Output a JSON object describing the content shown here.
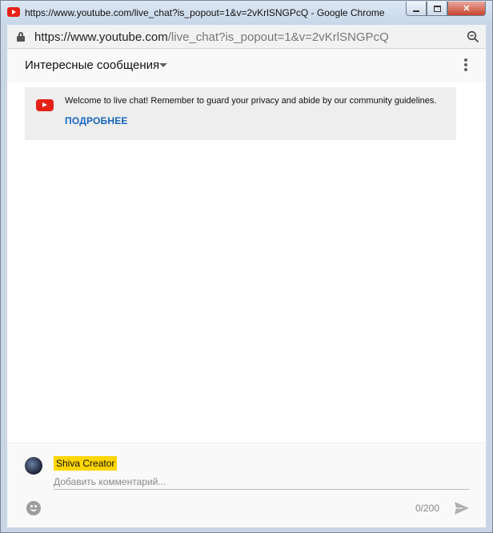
{
  "window": {
    "title": "https://www.youtube.com/live_chat?is_popout=1&v=2vKrlSNGPcQ - Google Chrome",
    "minimize_label": "",
    "close_label": "✕"
  },
  "addressbar": {
    "url_host": "https://www.youtube.com",
    "url_path": "/live_chat?is_popout=1&v=2vKrlSNGPcQ"
  },
  "chat": {
    "header_title": "Интересные сообщения",
    "welcome_message": "Welcome to live chat! Remember to guard your privacy and abide by our community guidelines.",
    "learn_more_label": "ПОДРОБНЕЕ"
  },
  "input": {
    "author_name": "Shiva Creator",
    "placeholder": "Добавить комментарий...",
    "value": "",
    "counter": "0/200"
  },
  "colors": {
    "youtube_red": "#e62117",
    "link_blue": "#1565c0",
    "author_highlight": "#ffd600"
  },
  "icons": [
    "youtube-icon",
    "lock-icon",
    "zoom-icon",
    "chevron-down-icon",
    "more-vert-icon",
    "emoji-icon",
    "send-icon"
  ]
}
